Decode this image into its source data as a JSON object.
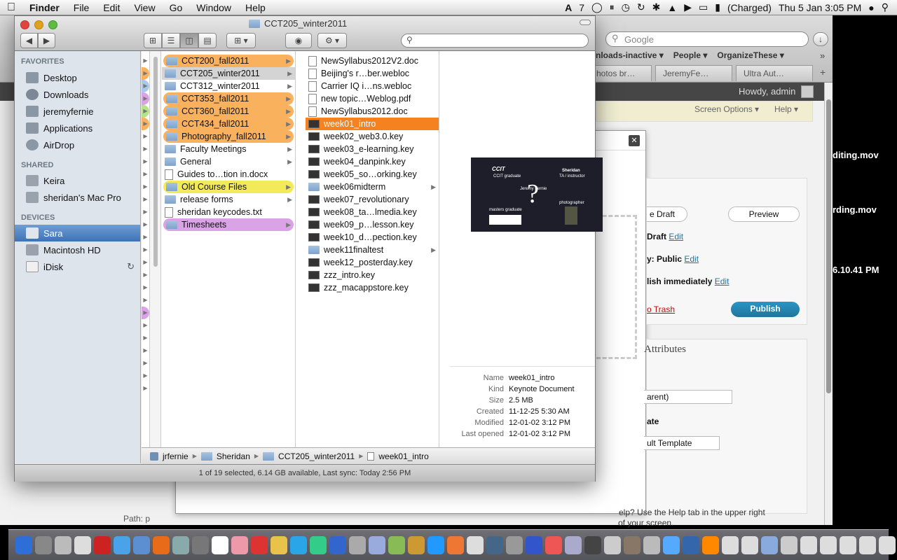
{
  "menubar": {
    "app_name": "Finder",
    "items": [
      "File",
      "Edit",
      "View",
      "Go",
      "Window",
      "Help"
    ],
    "status_number": "7",
    "battery": "(Charged)",
    "clock": "Thu 5 Jan  3:05 PM"
  },
  "browser": {
    "search_placeholder": "Google",
    "bookmarks": [
      "nloads-inactive ▾",
      "People ▾",
      "OrganizeThese ▾"
    ],
    "tabs": [
      "hotos br…",
      "JeremyFe…",
      "Ultra Aut…"
    ],
    "howdy": "Howdy, admin",
    "screen_options": "Screen Options ▾",
    "help": "Help ▾",
    "save_draft": "e Draft",
    "preview": "Preview",
    "draft_text": "Draft",
    "edit": "Edit",
    "visibility": "y: Public",
    "publish_immediately": "lish immediately",
    "move_to_trash": "o Trash",
    "publish_btn": "Publish",
    "attributes": "Attributes",
    "parent": "arent)",
    "template_label": "ate",
    "template_select": "ult Template",
    "help_text_1": "elp? Use the Help tab in the upper right",
    "help_text_2": "of your screen.",
    "path": "Path: p"
  },
  "desktop": {
    "files": [
      "diting.mov",
      "rding.mov",
      "6.10.41 PM"
    ]
  },
  "finder": {
    "title": "CCT205_winter2011",
    "sidebar": {
      "favorites_header": "FAVORITES",
      "favorites": [
        "Desktop",
        "Downloads",
        "jeremyfernie",
        "Applications",
        "AirDrop"
      ],
      "shared_header": "SHARED",
      "shared": [
        "Keira",
        "sheridan's Mac Pro"
      ],
      "devices_header": "DEVICES",
      "devices": [
        "Sara",
        "Macintosh HD",
        "iDisk"
      ]
    },
    "column1": [
      {
        "name": "CCT200_fall2011",
        "label": "orange"
      },
      {
        "name": "CCT205_winter2011",
        "label": "none",
        "selected": true
      },
      {
        "name": "CCT312_winter2011",
        "label": "none"
      },
      {
        "name": "CCT353_fall2011",
        "label": "orange"
      },
      {
        "name": "CCT360_fall2011",
        "label": "orange"
      },
      {
        "name": "CCT434_fall2011",
        "label": "orange"
      },
      {
        "name": "Photography_fall2011",
        "label": "orange"
      },
      {
        "name": "Faculty Meetings",
        "label": "none"
      },
      {
        "name": "General",
        "label": "none"
      },
      {
        "name": "Guides to…tion in.docx",
        "label": "none",
        "doc": true
      },
      {
        "name": "Old Course Files",
        "label": "yellow"
      },
      {
        "name": "release forms",
        "label": "none"
      },
      {
        "name": "sheridan keycodes.txt",
        "label": "none",
        "doc": true
      },
      {
        "name": "Timesheets",
        "label": "purple"
      }
    ],
    "column2": [
      {
        "name": "NewSyllabus2012V2.doc"
      },
      {
        "name": "Beijing's r…ber.webloc"
      },
      {
        "name": "Carrier IQ i…ns.webloc"
      },
      {
        "name": "new topic…Weblog.pdf"
      },
      {
        "name": "NewSyllabus2012.doc"
      },
      {
        "name": "week01_intro",
        "selected": true
      },
      {
        "name": "week02_web3.0.key"
      },
      {
        "name": "week03_e-learning.key"
      },
      {
        "name": "week04_danpink.key"
      },
      {
        "name": "week05_so…orking.key"
      },
      {
        "name": "week06midterm",
        "folder": true
      },
      {
        "name": "week07_revolutionary"
      },
      {
        "name": "week08_ta…lmedia.key"
      },
      {
        "name": "week09_p…lesson.key"
      },
      {
        "name": "week10_d…pection.key"
      },
      {
        "name": "week11finaltest",
        "folder": true
      },
      {
        "name": "week12_posterday.key"
      },
      {
        "name": "zzz_intro.key"
      },
      {
        "name": "zzz_macappstore.key"
      }
    ],
    "preview": {
      "slide_texts": [
        "CCIT",
        "CCIT graduate",
        "Sheridan",
        "TA / instructor",
        "Jeremy Fernie",
        "?",
        "masters graduate",
        "photographer"
      ],
      "info": [
        {
          "k": "Name",
          "v": "week01_intro"
        },
        {
          "k": "Kind",
          "v": "Keynote Document"
        },
        {
          "k": "Size",
          "v": "2.5 MB"
        },
        {
          "k": "Created",
          "v": "11-12-25 5:30 AM"
        },
        {
          "k": "Modified",
          "v": "12-01-02 3:12 PM"
        },
        {
          "k": "Last opened",
          "v": "12-01-02 3:12 PM"
        }
      ]
    },
    "path": [
      "jrfernie",
      "Sheridan",
      "CCT205_winter2011",
      "week01_intro"
    ],
    "status": "1 of 19 selected, 6.14 GB available, Last sync: Today 2:56 PM"
  },
  "colors": {
    "orange_label": "#f9b15e",
    "yellow_label": "#f3ea5a",
    "purple_label": "#d9a3e6",
    "selection": "#f5821f",
    "sidebar_selection": "#3d72b6"
  }
}
